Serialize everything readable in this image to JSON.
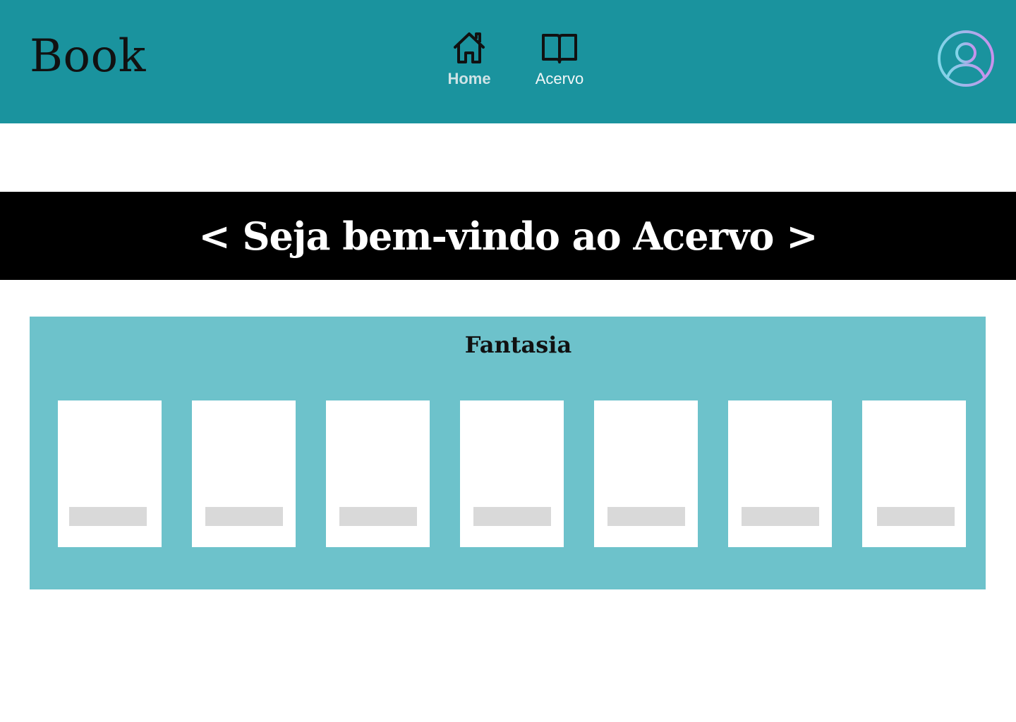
{
  "header": {
    "brand": "Book",
    "nav": [
      {
        "label": "Home",
        "icon": "home-icon",
        "active": true
      },
      {
        "label": "Acervo",
        "icon": "open-book-icon",
        "active": false
      }
    ],
    "avatar_icon": "user-avatar-icon"
  },
  "banner": {
    "title": "< Seja bem-vindo ao Acervo >"
  },
  "category": {
    "title": "Fantasia",
    "books": [
      {
        "title": ""
      },
      {
        "title": ""
      },
      {
        "title": ""
      },
      {
        "title": ""
      },
      {
        "title": ""
      },
      {
        "title": ""
      },
      {
        "title": ""
      }
    ]
  },
  "colors": {
    "header_bg": "#1a939e",
    "category_bg": "#6dc2cb",
    "banner_bg": "#000000",
    "placeholder": "#d9d9d9"
  }
}
